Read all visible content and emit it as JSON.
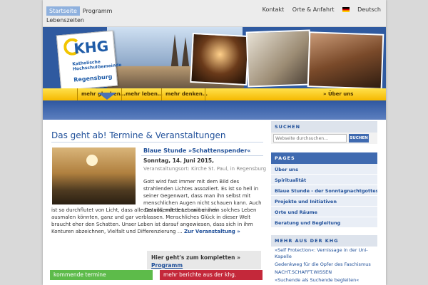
{
  "topnav": {
    "home_label": "Startseite",
    "program_label": "Programm",
    "lebenszeiten_label": "Lebenszeiten",
    "kontakt_label": "Kontakt",
    "orte_label": "Orte & Anfahrt",
    "lang_label": "Deutsch"
  },
  "logo": {
    "abbr": "KHG",
    "subtitle": "Katholische HochschulGemeinde",
    "city": "Regensburg"
  },
  "mainnav": {
    "items": [
      "mehr glauben…",
      "mehr leben…",
      "mehr denken…"
    ],
    "right_item": "» Über uns"
  },
  "main": {
    "heading": "Das geht ab! Termine & Veranstaltungen",
    "event": {
      "title": "Blaue Stunde »Schattenspender«",
      "date": "Sonntag, 14. Juni 2015,",
      "place": "Veranstaltungsort: Kirche St. Paul, in Regensburg",
      "text_a": "Gott wird fast immer mit dem Bild des strahlenden Lichtes assoziiert. Es ist so hell in seiner Gegenwart, dass man ihn selbst mit menschlichen Augen nicht schauen kann. Auch das vollendete Leben bei ihm",
      "text_b": "ist so durchflutet von Licht, dass alle Details, mit denen wir uns ein solches Leben ausmalen könnten, ganz und gar verblassen. Menschliches Glück in dieser Welt braucht eher den Schatten. Unser Leben ist darauf angewiesen, dass sich in ihm Konturen abzeichnen, Vielfalt und Differenzierung …",
      "more_link": "Zur Veranstaltung »"
    },
    "callout_text": "Hier geht's zum kompletten »",
    "callout_link": "Programm",
    "callout_arrow": "»",
    "btn_upcoming": "kommende termine",
    "btn_reports": "mehr berichte aus der khg."
  },
  "sidebar": {
    "search_head": "SUCHEN",
    "search_placeholder": "Webseite durchsuchen…",
    "search_button": "SUCHEN",
    "pages_head": "PAGES",
    "pages": [
      "Über uns",
      "Spiritualität",
      "Blaue Stunde - der Sonntagnachtgottesdienst",
      "Projekte und Initiativen",
      "Orte und Räume",
      "Beratung und Begleitung"
    ],
    "more_head": "MEHR AUS DER KHG",
    "more": [
      "»Self Protection«: Vernissage in der Uni-Kapelle",
      "Gedenkweg für die Opfer des Faschismus",
      "NACHT.SCHAFFT.WISSEN",
      "»Suchende als Suchende begleiten«"
    ]
  },
  "colors": {
    "accent_blue": "#1f4f99",
    "yellow_bar": "#f5b800",
    "green": "#5dbb4a",
    "red": "#c4283a"
  }
}
